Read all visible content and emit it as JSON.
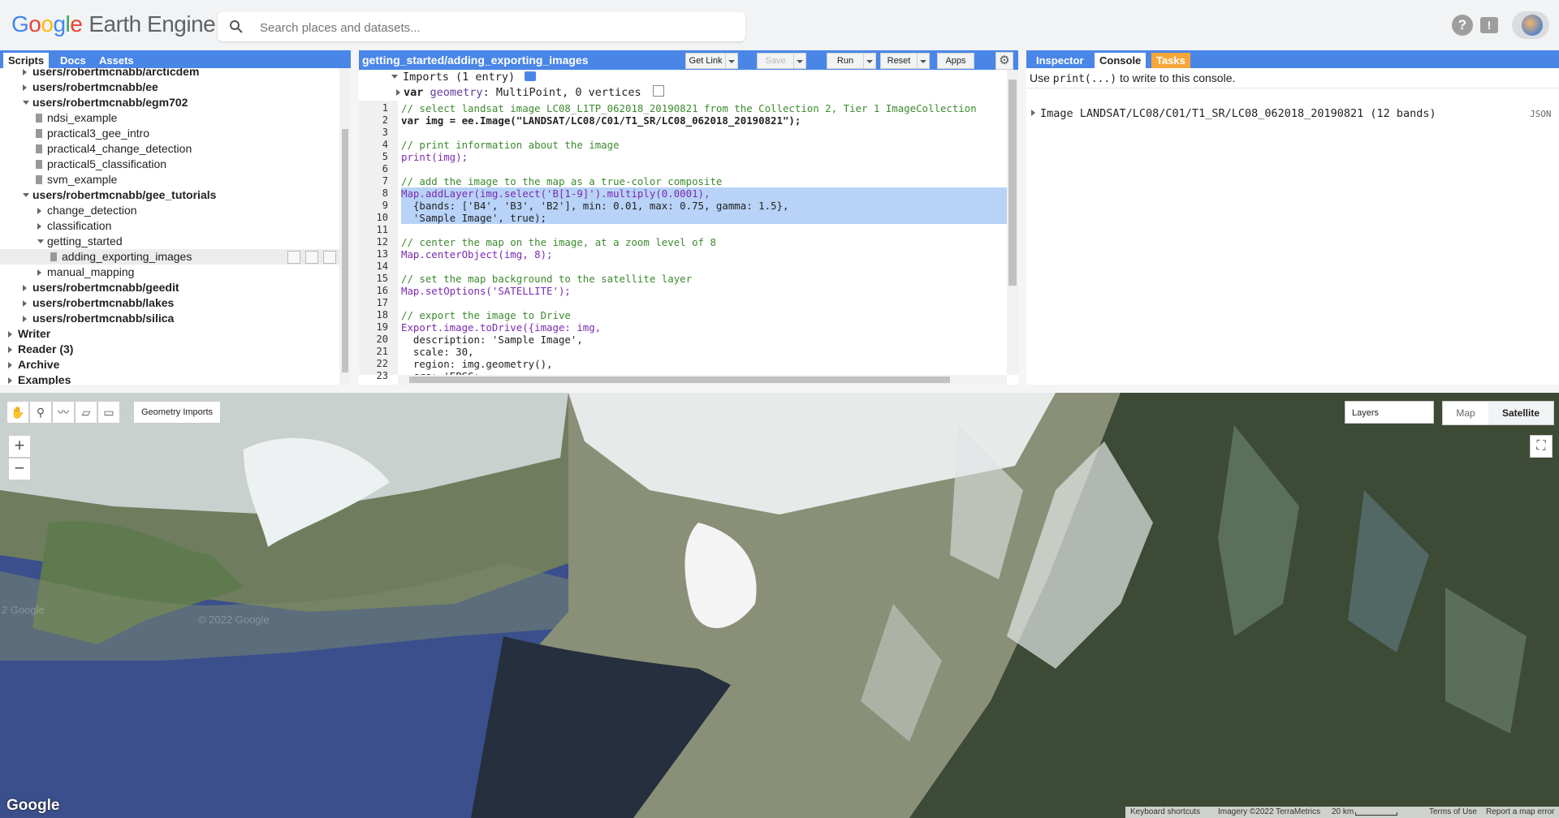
{
  "header": {
    "logo_parts": [
      "G",
      "o",
      "o",
      "g",
      "l",
      "e"
    ],
    "logo_product": "Earth Engine",
    "search_placeholder": "Search places and datasets...",
    "help_icon": "help-icon",
    "feedback_icon": "feedback-icon"
  },
  "left_panel": {
    "tabs": [
      "Scripts",
      "Docs",
      "Assets"
    ],
    "tree": [
      {
        "label": "users/robertmcnabb/arcticdem",
        "bold": true,
        "expanded": false
      },
      {
        "label": "users/robertmcnabb/ee",
        "bold": true,
        "expanded": false
      },
      {
        "label": "users/robertmcnabb/egm702",
        "bold": true,
        "expanded": true
      },
      {
        "label": "ndsi_example",
        "type": "file"
      },
      {
        "label": "practical3_gee_intro",
        "type": "file"
      },
      {
        "label": "practical4_change_detection",
        "type": "file"
      },
      {
        "label": "practical5_classification",
        "type": "file"
      },
      {
        "label": "svm_example",
        "type": "file"
      },
      {
        "label": "users/robertmcnabb/gee_tutorials",
        "bold": true,
        "expanded": true
      },
      {
        "label": "change_detection",
        "type": "folder",
        "expanded": false
      },
      {
        "label": "classification",
        "type": "folder",
        "expanded": false
      },
      {
        "label": "getting_started",
        "type": "folder",
        "expanded": true
      },
      {
        "label": "adding_exporting_images",
        "type": "file",
        "selected": true
      },
      {
        "label": "manual_mapping",
        "type": "folder",
        "expanded": false
      },
      {
        "label": "users/robertmcnabb/geedit",
        "bold": true,
        "expanded": false
      },
      {
        "label": "users/robertmcnabb/lakes",
        "bold": true,
        "expanded": false
      },
      {
        "label": "users/robertmcnabb/silica",
        "bold": true,
        "expanded": false
      },
      {
        "label": "Writer",
        "bold": true,
        "expanded": false
      },
      {
        "label": "Reader (3)",
        "bold": true,
        "expanded": false
      },
      {
        "label": "Archive",
        "bold": true,
        "expanded": false
      },
      {
        "label": "Examples",
        "bold": true,
        "expanded": false
      }
    ]
  },
  "editor": {
    "title": "getting_started/adding_exporting_images",
    "buttons": {
      "get_link": "Get Link",
      "save": "Save",
      "run": "Run",
      "reset": "Reset",
      "apps": "Apps"
    },
    "imports_label": "Imports (1 entry)",
    "import_var_kw": "var",
    "import_var_name": "geometry",
    "import_var_desc": ": MultiPoint, 0 vertices",
    "line_numbers": [
      "1",
      "2",
      "3",
      "4",
      "5",
      "6",
      "7",
      "8",
      "9",
      "10",
      "11",
      "12",
      "13",
      "14",
      "15",
      "16",
      "17",
      "18",
      "19",
      "20",
      "21",
      "22",
      "23"
    ],
    "code": [
      "// select landsat image LC08_L1TP_062018_20190821 from the Collection 2, Tier 1 ImageCollection",
      "var img = ee.Image(\"LANDSAT/LC08/C01/T1_SR/LC08_062018_20190821\");",
      "",
      "// print information about the image",
      "print(img);",
      "",
      "// add the image to the map as a true-color composite",
      "Map.addLayer(img.select('B[1-9]').multiply(0.0001),",
      "  {bands: ['B4', 'B3', 'B2'], min: 0.01, max: 0.75, gamma: 1.5},",
      "  'Sample Image', true);",
      "",
      "// center the map on the image, at a zoom level of 8",
      "Map.centerObject(img, 8);",
      "",
      "// set the map background to the satellite layer",
      "Map.setOptions('SATELLITE');",
      "",
      "// export the image to Drive",
      "Export.image.toDrive({image: img,",
      "  description: 'Sample Image',",
      "  scale: 30,",
      "  region: img.geometry(),",
      "  crs: 'EPSG:..."
    ],
    "highlighted_lines": [
      8,
      9,
      10
    ]
  },
  "right_panel": {
    "tabs": [
      "Inspector",
      "Console",
      "Tasks"
    ],
    "hint_prefix": "Use ",
    "hint_code": "print(...)",
    "hint_suffix": " to write to this console.",
    "entry": "Image LANDSAT/LC08/C01/T1_SR/LC08_062018_20190821 (12 bands)",
    "json_label": "JSON"
  },
  "map": {
    "geometry_imports": "Geometry Imports",
    "zoom_in": "+",
    "zoom_out": "−",
    "layers": "Layers",
    "map_type_map": "Map",
    "map_type_satellite": "Satellite",
    "watermark": "Google",
    "faint_copyright_1": "2 Google",
    "faint_copyright_2": "© 2022 Google",
    "attribution": {
      "shortcuts": "Keyboard shortcuts",
      "imagery": "Imagery ©2022 TerraMetrics",
      "scale": "20 km",
      "terms": "Terms of Use",
      "report": "Report a map error"
    }
  }
}
